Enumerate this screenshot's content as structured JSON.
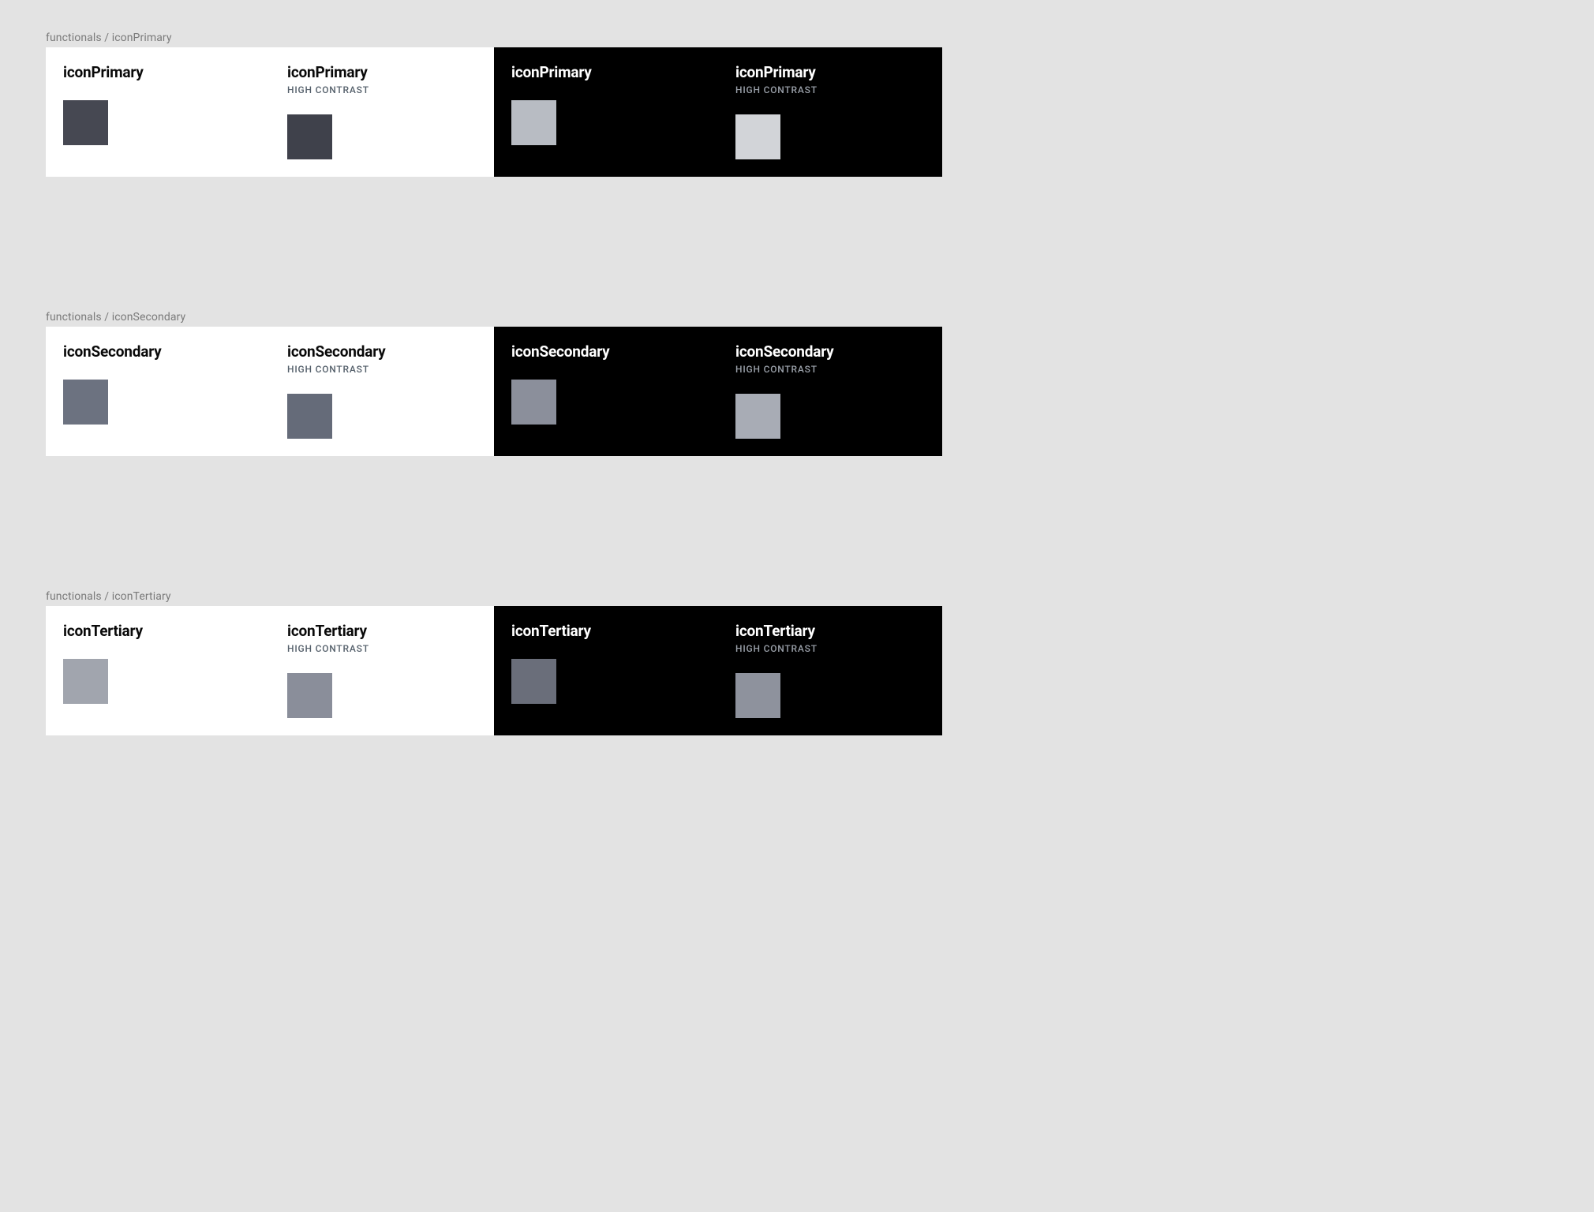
{
  "labels": {
    "high_contrast": "HIGH CONTRAST"
  },
  "sections": [
    {
      "header": "functionals / iconPrimary",
      "token": "iconPrimary",
      "light": {
        "swatch": "#464852"
      },
      "light_hc": {
        "swatch": "#3f414b"
      },
      "dark": {
        "swatch": "#b8bcc3"
      },
      "dark_hc": {
        "swatch": "#d2d4d8"
      }
    },
    {
      "header": "functionals / iconSecondary",
      "token": "iconSecondary",
      "light": {
        "swatch": "#6c7280"
      },
      "light_hc": {
        "swatch": "#656b79"
      },
      "dark": {
        "swatch": "#8b8f9b"
      },
      "dark_hc": {
        "swatch": "#a8acb5"
      }
    },
    {
      "header": "functionals / iconTertiary",
      "token": "iconTertiary",
      "light": {
        "swatch": "#a1a5ae"
      },
      "light_hc": {
        "swatch": "#8a8e9a"
      },
      "dark": {
        "swatch": "#6a6e7a"
      },
      "dark_hc": {
        "swatch": "#8e929d"
      }
    }
  ]
}
